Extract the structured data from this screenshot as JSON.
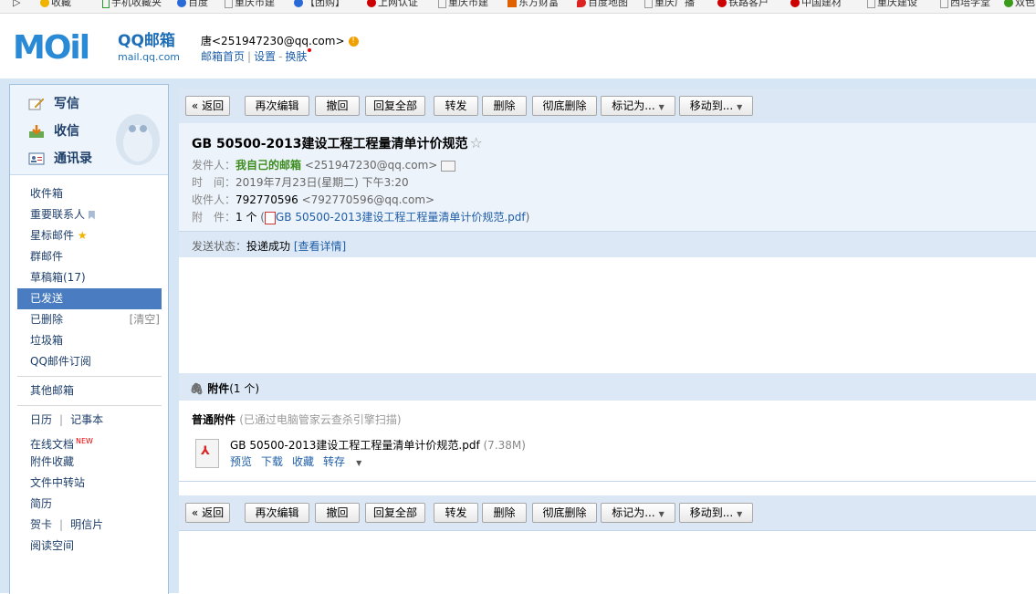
{
  "bookmarks": [
    {
      "label": "收藏",
      "color": "#f0b400"
    },
    {
      "label": "手机收藏夹",
      "color": "#2a9a2a"
    },
    {
      "label": "百度",
      "color": "#2a6ad6"
    },
    {
      "label": "重庆市建",
      "color": "#888"
    },
    {
      "label": "【团购】",
      "color": "#2a6ad6"
    },
    {
      "label": "上网认证",
      "color": "#c00"
    },
    {
      "label": "重庆市建",
      "color": "#888"
    },
    {
      "label": "东方财富",
      "color": "#e06000"
    },
    {
      "label": "百度地图",
      "color": "#d22"
    },
    {
      "label": "重庆广播",
      "color": "#888"
    },
    {
      "label": "铁路客户",
      "color": "#c00"
    },
    {
      "label": "中国建材",
      "color": "#c00"
    },
    {
      "label": "重庆建设",
      "color": "#888"
    },
    {
      "label": "西培学堂",
      "color": "#888"
    },
    {
      "label": "双色",
      "color": "#3a9a1a"
    }
  ],
  "header": {
    "logo_text": "MOil",
    "logo_brand": "QQ邮箱",
    "logo_url": "mail.qq.com",
    "user": "唐<251947230@qq.com>",
    "links": [
      "邮箱首页",
      "设置",
      "换肤"
    ]
  },
  "sidebar": {
    "quick": [
      {
        "label": "写信",
        "icon": "pen-icon"
      },
      {
        "label": "收信",
        "icon": "inbox-icon"
      },
      {
        "label": "通讯录",
        "icon": "contacts-icon"
      }
    ],
    "folders": [
      {
        "label": "收件箱"
      },
      {
        "label": "重要联系人"
      },
      {
        "label": "星标邮件"
      },
      {
        "label": "群邮件"
      },
      {
        "label": "草稿箱(17)"
      },
      {
        "label": "已发送",
        "active": true
      },
      {
        "label": "已删除",
        "right": "[清空]"
      },
      {
        "label": "垃圾箱"
      },
      {
        "label": "QQ邮件订阅"
      }
    ],
    "other_mail": "其他邮箱",
    "tools": {
      "calendar": "日历",
      "notes": "记事本",
      "docs": "在线文档",
      "docs_badge": "NEW",
      "att_fav": "附件收藏",
      "transfer": "文件中转站",
      "resume": "简历",
      "card": "贺卡",
      "postcard": "明信片",
      "reading": "阅读空间"
    }
  },
  "toolbar": {
    "back": "« 返回",
    "reedit": "再次编辑",
    "recall": "撤回",
    "reply_all": "回复全部",
    "forward": "转发",
    "delete": "删除",
    "delete_forever": "彻底删除",
    "mark_as": "标记为...",
    "move_to": "移动到..."
  },
  "message": {
    "subject": "GB 50500-2013建设工程工程量清单计价规范",
    "from_label": "发件人：",
    "from_name": "我自己的邮箱",
    "from_addr": "<251947230@qq.com>",
    "time_label": "时　间：",
    "time": "2019年7月23日(星期二) 下午3:20",
    "to_label": "收件人：",
    "to_name": "792770596",
    "to_addr": "<792770596@qq.com>",
    "att_label": "附　件：",
    "att_count": "1 个",
    "att_file_open": " (",
    "att_file": "GB 50500-2013建设工程工程量清单计价规范.pdf",
    "att_file_close": ")",
    "status_label": "发送状态：",
    "status_value": "投递成功",
    "status_link": "[查看详情]"
  },
  "attachments": {
    "header": "附件",
    "count": "(1 个)",
    "kind": "普通附件",
    "scan": "(已通过电脑管家云查杀引擎扫描)",
    "files": [
      {
        "name": "GB 50500-2013建设工程工程量清单计价规范.pdf",
        "size": "(7.38M)",
        "actions": [
          "预览",
          "下载",
          "收藏",
          "转存"
        ]
      }
    ]
  }
}
